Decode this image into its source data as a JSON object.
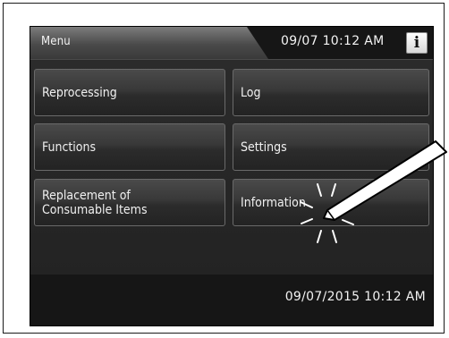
{
  "header": {
    "title": "Menu",
    "datetime": "09/07 10:12 AM",
    "info_button_label": "i"
  },
  "menu": {
    "buttons": [
      {
        "label": "Reprocessing"
      },
      {
        "label": "Log"
      },
      {
        "label": "Functions"
      },
      {
        "label": "Settings"
      },
      {
        "label": "Replacement of\nConsumable Items"
      },
      {
        "label": "Information"
      }
    ]
  },
  "status_bar": {
    "datetime": "09/07/2015 10:12 AM"
  },
  "colors": {
    "screen_background": "#161616",
    "button_text": "#f0f0f0"
  },
  "icons": {
    "info": "info-icon",
    "stylus": "stylus-icon",
    "touch": "touch-indicator-icon"
  }
}
